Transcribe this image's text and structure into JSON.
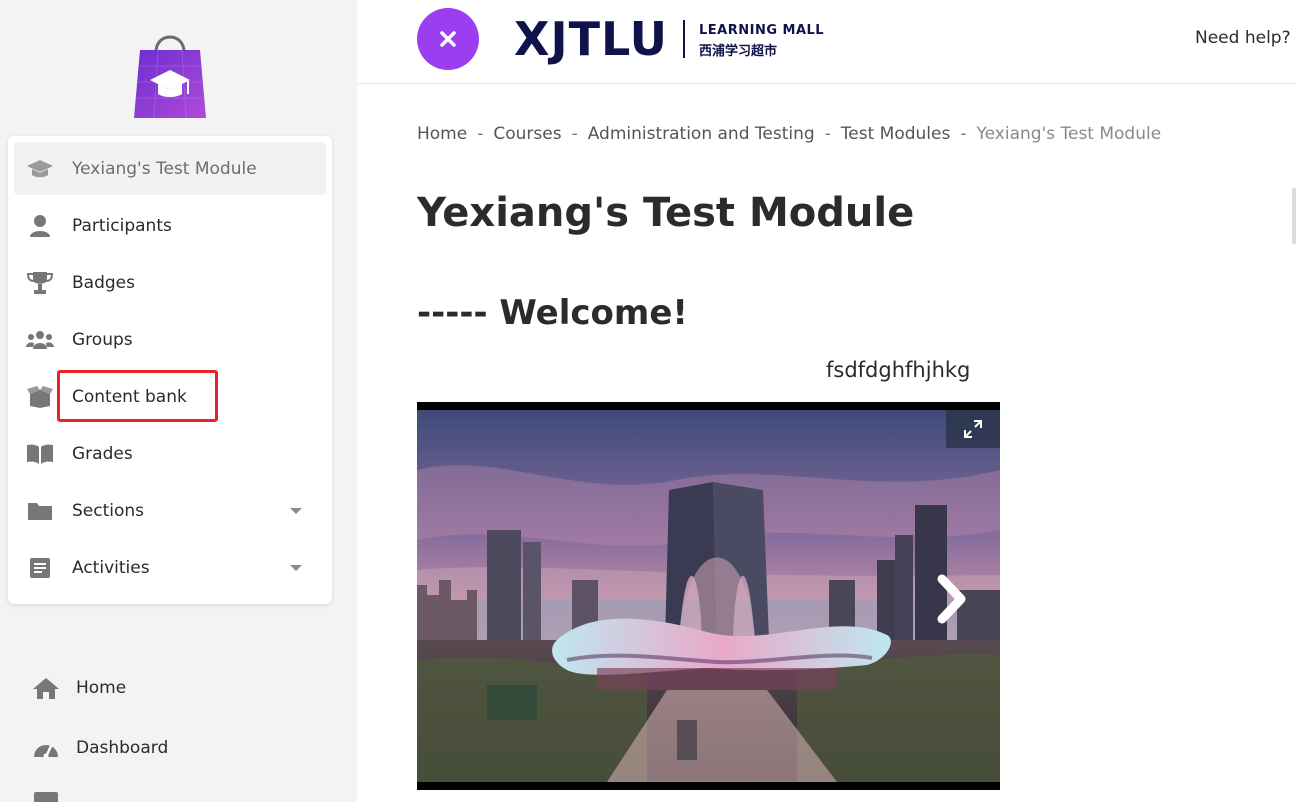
{
  "header": {
    "brand_name": "XJTLU",
    "brand_sub_en": "LEARNING MALL",
    "brand_sub_cn": "西浦学习超市",
    "help_link": "Need help?",
    "close_icon": "close-icon",
    "accent_color": "#9b3ef0"
  },
  "sidebar": {
    "logo_icon": "shopping-bag-graduation-cap-logo",
    "course_nav": [
      {
        "label": "Yexiang's Test Module",
        "icon": "graduation-cap-icon",
        "active": true
      },
      {
        "label": "Participants",
        "icon": "user-icon"
      },
      {
        "label": "Badges",
        "icon": "trophy-icon"
      },
      {
        "label": "Groups",
        "icon": "users-icon"
      },
      {
        "label": "Content bank",
        "icon": "box-open-icon",
        "highlighted": true
      },
      {
        "label": "Grades",
        "icon": "book-open-icon"
      },
      {
        "label": "Sections",
        "icon": "folder-icon",
        "expandable": true
      },
      {
        "label": "Activities",
        "icon": "file-list-icon",
        "expandable": true
      }
    ],
    "site_nav": [
      {
        "label": "Home",
        "icon": "home-icon"
      },
      {
        "label": "Dashboard",
        "icon": "dashboard-icon"
      }
    ],
    "highlight_color": "#e8242b"
  },
  "breadcrumb": [
    "Home",
    "Courses",
    "Administration and Testing",
    "Test Modules",
    "Yexiang's Test Module"
  ],
  "main": {
    "title": "Yexiang's Test Module",
    "welcome": "----- Welcome!",
    "random_text": "fsdfdghfhjhkg",
    "carousel": {
      "image": "suzhou-gate-of-the-orient-skyline-photo",
      "fullscreen_icon": "expand-icon",
      "next_icon": "chevron-right-icon"
    }
  }
}
